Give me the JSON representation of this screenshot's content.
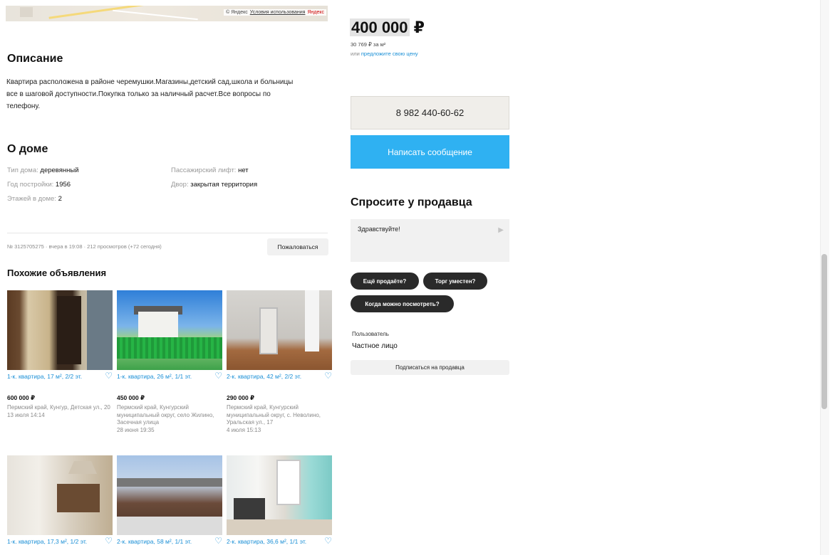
{
  "map": {
    "attribution": "© Яндекс",
    "terms": "Условия использования",
    "brand": "Яндекс"
  },
  "description": {
    "title": "Описание",
    "text": "Квартира расположена в районе черемушки.Магазины,детский сад,школа и больницы все в шаговой доступности.Покупка только за наличный расчет.Все вопросы по телефону."
  },
  "house": {
    "title": "О доме",
    "left": [
      {
        "label": "Тип дома:",
        "value": "деревянный"
      },
      {
        "label": "Год постройки:",
        "value": "1956"
      },
      {
        "label": "Этажей в доме:",
        "value": "2"
      }
    ],
    "right": [
      {
        "label": "Пассажирский лифт:",
        "value": "нет"
      },
      {
        "label": "Двор:",
        "value": "закрытая территория"
      }
    ]
  },
  "meta": {
    "text": "№ 3125705275 · вчера в 19:08 · 212 просмотров (+72 сегодня)",
    "report": "Пожаловаться"
  },
  "similar": {
    "title": "Похожие объявления",
    "items": [
      {
        "title": "1-к. квартира, 17 м², 2/2 эт.",
        "price": "600 000 ₽",
        "address": "Пермский край, Кунгур, Детская ул., 20",
        "date": "13 июля 14:14"
      },
      {
        "title": "1-к. квартира, 26 м², 1/1 эт.",
        "price": "450 000 ₽",
        "address": "Пермский край, Кунгурский муниципальный округ, село Жилино, Засечная улица",
        "date": "28 июня 19:35"
      },
      {
        "title": "2-к. квартира, 42 м², 2/2 эт.",
        "price": "290 000 ₽",
        "address": "Пермский край, Кунгурский муниципальный округ, с. Неволино, Уральская ул., 17",
        "date": "4 июля 15:13"
      },
      {
        "title": "1-к. квартира, 17,3 м², 1/2 эт.",
        "price": "",
        "address": "",
        "date": ""
      },
      {
        "title": "2-к. квартира, 58 м², 1/1 эт.",
        "price": "",
        "address": "",
        "date": ""
      },
      {
        "title": "2-к. квартира, 36,6 м², 1/1 эт.",
        "price": "",
        "address": "",
        "date": ""
      }
    ]
  },
  "pricing": {
    "main": "400 000",
    "currency": "₽",
    "per_sqm": "30 769 ₽ за м²",
    "offer_prefix": "или",
    "offer_link": "предложите свою цену"
  },
  "contact": {
    "phone": "8 982 440-60-62",
    "message": "Написать сообщение"
  },
  "ask": {
    "title": "Спросите у продавца",
    "placeholder": "Здравствуйте!",
    "chips": [
      "Ещё продаёте?",
      "Торг уместен?",
      "Когда можно посмотреть?"
    ]
  },
  "seller": {
    "kind": "Пользователь",
    "name": "Частное лицо",
    "subscribe": "Подписаться на продавца"
  },
  "colors": {
    "link": "#1a8fd6",
    "primary_button": "#2fb1f2",
    "chip": "#2a2a2a"
  }
}
